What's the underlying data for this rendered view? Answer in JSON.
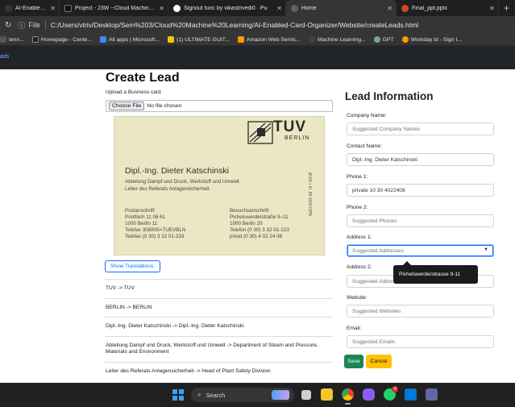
{
  "browser": {
    "tabs": [
      {
        "title": "AI-Enabled-Card-Or",
        "color": "#333333",
        "active": false
      },
      {
        "title": "Project - 23W --Cloud Machine L",
        "color": "#111111",
        "active": false
      },
      {
        "title": "Signout func by vikastrivedi0 · Pu",
        "color": "#111111",
        "active": false
      },
      {
        "title": "Home",
        "color": "#5f6368",
        "active": true
      },
      {
        "title": "Final_ppt.pptx",
        "color": "#d24726",
        "active": false
      }
    ],
    "new_tab_glyph": "+",
    "address": {
      "info_glyph": "ⓘ",
      "file_label": "File",
      "url": "C:/Users/vtriv/Desktop/Sem%203/Cloud%20Machine%20Learning/AI-Enabled-Card-Organizer/Website/createLeads.html"
    },
    "bookmarks": [
      {
        "label": "tenn...",
        "color": "#555555"
      },
      {
        "label": "Homepage - Cente...",
        "color": "#222222"
      },
      {
        "label": "All apps | Microsoft...",
        "color": "#4285f4"
      },
      {
        "label": "(1) ULTIMATE GUIT...",
        "color": "#f1c40f"
      },
      {
        "label": "Amazon Web Servic...",
        "color": "#ff9900"
      },
      {
        "label": "Machine Learning...",
        "color": "#444444"
      },
      {
        "label": "GPT",
        "color": "#74aa9c"
      },
      {
        "label": "Workday td - Sign I...",
        "color": "#f29f05"
      }
    ]
  },
  "site": {
    "nav_brand": "ads"
  },
  "page": {
    "title": "Create Lead",
    "upload_label": "Upload a Business card",
    "file_button": "Choose File",
    "file_status": "No file chosen",
    "show_translations": "Show Translations:",
    "translations": [
      "TUV -> TUV",
      "BERLIN -> BERLIN",
      "Dipl.-Ing. Dieter Katschinski -> Dipl.-Ing. Dieter Katschinski",
      "Abteilung Dampf und Druck, Werkstoff und Umwelt -> Department of Steam and Pressure, Materials and Environment",
      "Leiter des Referats Anlagensicherheit -> Head of Plant Safety Division"
    ]
  },
  "card": {
    "logo_text": "TUV",
    "logo_sub": "BERLIN",
    "name": "Dipl.-Ing. Dieter Katschinski",
    "dept1": "Abteilung Dampf und Druck, Werkstoff und Umwelt",
    "dept2": "Leiter des Referats Anlagensicherheit",
    "postal_head": "Postanschrift:",
    "postal1": "Postfach 11 06 61",
    "postal2": "1000 Berlin 11",
    "postal3": "Telefax 308805=TUEVBLN",
    "postal4": "Telefax (0 30) 3 32 01-233",
    "visit_head": "Besuchsanschrift:",
    "visit1": "Pichelswerderstraße 9–11",
    "visit2": "1000 Berlin 20",
    "visit3": "Telefon (0 30) 3 32 01-223",
    "visit4": "privat   (0 30) 4 02 24 08",
    "vertical": "Ø DS • III. 88 1000 DPN"
  },
  "form": {
    "title": "Lead Information",
    "fields": [
      {
        "label": "Company Name:",
        "value": "Suggested Company Names",
        "placeholder": true
      },
      {
        "label": "Contact Name:",
        "value": "Dipl.-Ing. Dieter Katschinski",
        "placeholder": false
      },
      {
        "label": "Phone 1:",
        "value": "private 10 30 4022408",
        "placeholder": false
      },
      {
        "label": "Phone 2:",
        "value": "Suggested Phones",
        "placeholder": true
      },
      {
        "label": "Address 1:",
        "value": "Suggested Addresses",
        "placeholder": true,
        "dropdown": true
      },
      {
        "label": "Address 2:",
        "value": "Suggested Addresses",
        "placeholder": true
      },
      {
        "label": "Website:",
        "value": "Suggested Websites",
        "placeholder": true
      },
      {
        "label": "Email:",
        "value": "Suggested Emails",
        "placeholder": true
      }
    ],
    "tooltip": "Pichelswerderstrasse 9-11",
    "save_label": "Save",
    "cancel_label": "Cancel"
  },
  "taskbar": {
    "search_label": "Search",
    "apps": [
      {
        "name": "task-view",
        "color": "#cfcfcf"
      },
      {
        "name": "file-explorer",
        "color": "#f4c430"
      },
      {
        "name": "chrome",
        "color": "#34a853"
      },
      {
        "name": "proton",
        "color": "#8b5cf6"
      },
      {
        "name": "whatsapp",
        "color": "#25d366",
        "badge": "4"
      },
      {
        "name": "vscode",
        "color": "#0078d4"
      },
      {
        "name": "teams",
        "color": "#6264a7"
      }
    ]
  }
}
